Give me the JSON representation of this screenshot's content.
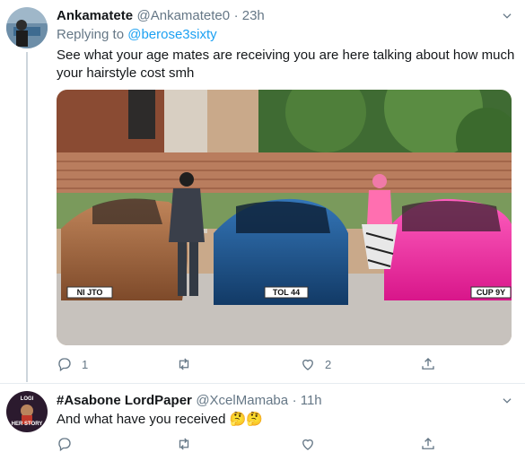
{
  "tweet1": {
    "display_name": "Ankamatete",
    "handle": "@Ankamatete0",
    "time": "· 23h",
    "replying_prefix": "Replying to",
    "replying_to": "@berose3sixty",
    "text_line1": "See what your age mates are receiving you are here talking about how much",
    "text_line2": "your hairstyle cost smh",
    "plates": [
      "NI JTO",
      "TOL 44",
      "CUP 9Y"
    ],
    "reply_count": "1",
    "retweet_count": "",
    "like_count": "2"
  },
  "tweet2": {
    "display_name": "#Asabone LordPaper",
    "handle": "@XcelMamaba",
    "time": "· 11h",
    "text": "And what have you received 🤔🤔",
    "avatar_text_top": "LOGI",
    "avatar_text_bottom": "HER STORY"
  },
  "colors": {
    "accent": "#1da1f2",
    "muted": "#657786",
    "car_bronze": "#a0643c",
    "car_blue": "#1b4f8a",
    "car_pink": "#ff2fa6"
  }
}
